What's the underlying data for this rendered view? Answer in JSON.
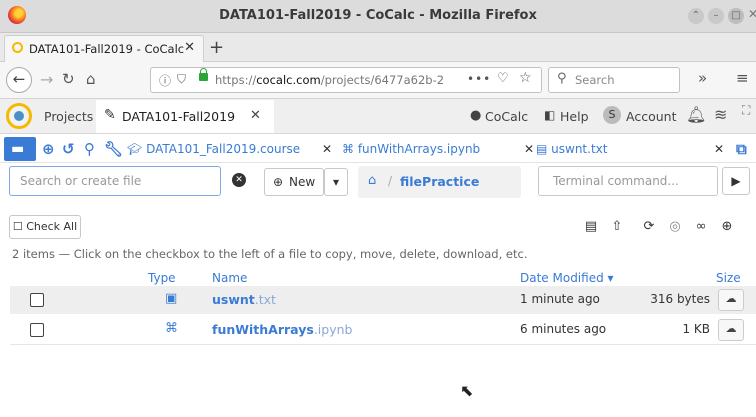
{
  "window": {
    "title": "DATA101-Fall2019 - CoCalc - Mozilla Firefox"
  },
  "browser_tab": {
    "label": "DATA101-Fall2019 - CoCalc",
    "close": "✕",
    "new_tab": "+"
  },
  "navbar": {
    "url_prefix": "https://",
    "url_host": "cocalc.com",
    "url_path": "/projects/6477a62b-2",
    "more": "•••",
    "search_placeholder": "Search",
    "overflow": "»",
    "menu": "≡"
  },
  "cocalc_top": {
    "projects": "Projects",
    "project_tab": "DATA101-Fall2019",
    "project_tab_close": "✕",
    "cocalc": "CoCalc",
    "help": "Help",
    "account": "Account",
    "account_badge": "S"
  },
  "file_tabs": [
    {
      "label": "DATA101_Fall2019.course",
      "close": "✕"
    },
    {
      "label": "funWithArrays.ipynb",
      "close": "✕"
    },
    {
      "label": "uswnt.txt",
      "close": "✕"
    }
  ],
  "search": {
    "placeholder": "Search or create file"
  },
  "new_button": {
    "label": "New"
  },
  "breadcrumb": {
    "sep": "/",
    "current": "filePractice"
  },
  "terminal": {
    "placeholder": "Terminal command..."
  },
  "check_all": {
    "label": "Check All"
  },
  "hint": "2 items — Click on the checkbox to the left of a file to copy, move, delete, download, etc.",
  "table": {
    "headers": {
      "type": "Type",
      "name": "Name",
      "date": "Date Modified",
      "size": "Size"
    },
    "rows": [
      {
        "name": "uswnt",
        "ext": ".txt",
        "date": "1 minute ago",
        "size": "316 bytes"
      },
      {
        "name": "funWithArrays",
        "ext": ".ipynb",
        "date": "6 minutes ago",
        "size": "1 KB"
      }
    ]
  }
}
